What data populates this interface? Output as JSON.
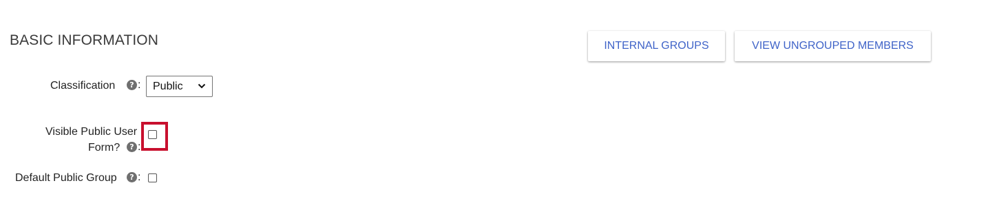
{
  "section": {
    "title": "BASIC INFORMATION"
  },
  "actions": {
    "internal_groups_label": "INTERNAL GROUPS",
    "view_ungrouped_label": "VIEW UNGROUPED MEMBERS"
  },
  "fields": {
    "classification": {
      "label": "Classification",
      "help_glyph": "?",
      "colon": ":",
      "selected": "Public"
    },
    "visible_public_user_form": {
      "label_line1": "Visible Public User",
      "label_line2": "Form?",
      "help_glyph": "?",
      "colon": ":",
      "checked": false
    },
    "default_public_group": {
      "label": "Default Public Group",
      "help_glyph": "?",
      "colon": ":",
      "checked": false
    }
  },
  "colors": {
    "accent_text": "#3f63c8",
    "highlight": "#c8102e"
  },
  "icons": {
    "help": "question-circle-icon",
    "select_caret": "chevron-down-icon"
  }
}
